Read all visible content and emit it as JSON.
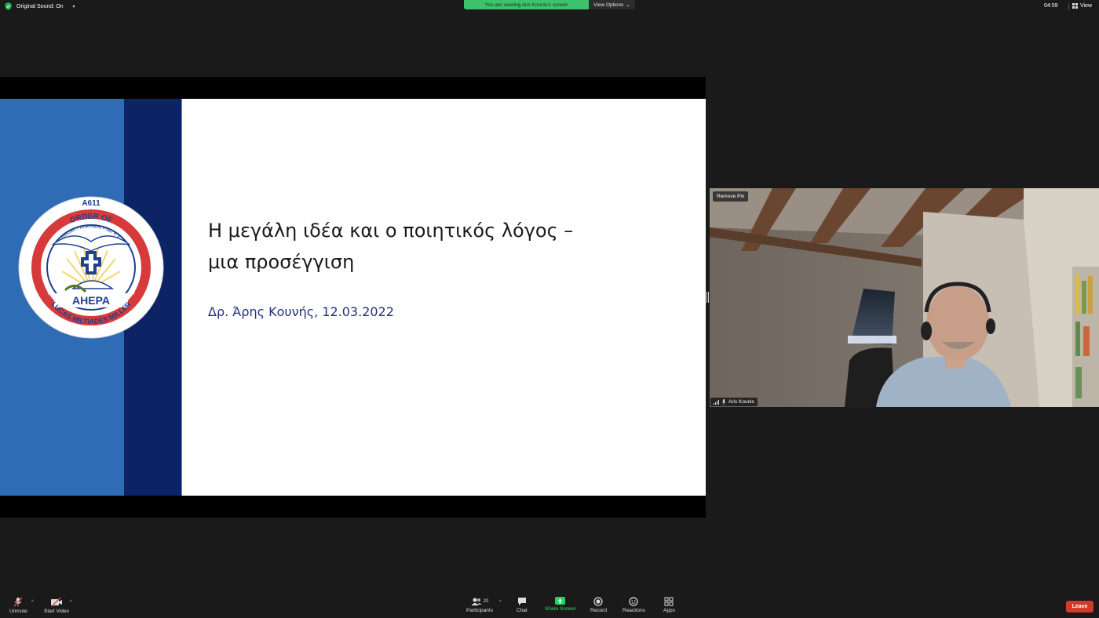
{
  "top_bar": {
    "original_sound": "Original Sound: On",
    "viewing_banner": "You are viewing Aris Kounis's screen",
    "view_options": "View Options",
    "clock": "04:59",
    "view": "View"
  },
  "slide": {
    "logo_texts": {
      "code": "A611",
      "region": "Hessen / Rheinland Pfalz e.V.",
      "order": "ORDER OF",
      "org": "AHEPA",
      "chapter": "LUCAS MILTIADES MILLER"
    },
    "title_line1": "Η μεγάλη ιδέα και ο ποιητικός λόγος –",
    "title_line2": "μια προσέγγιση",
    "subtitle": "Δρ. Άρης Κουνής, 12.03.2022",
    "band_colors": [
      "#2f6cb6",
      "#0c2466"
    ]
  },
  "video_tile": {
    "pin_button": "Remove Pin",
    "participant_name": "Aris Kounis"
  },
  "toolbar": {
    "unmute": "Unmute",
    "start_video": "Start Video",
    "participants": "Participants",
    "participant_count": "20",
    "chat": "Chat",
    "share_screen": "Share Screen",
    "record": "Record",
    "reactions": "Reactions",
    "apps": "Apps",
    "leave": "Leave"
  },
  "colors": {
    "accent_green": "#3ec26b",
    "leave_red": "#d33a2c"
  }
}
